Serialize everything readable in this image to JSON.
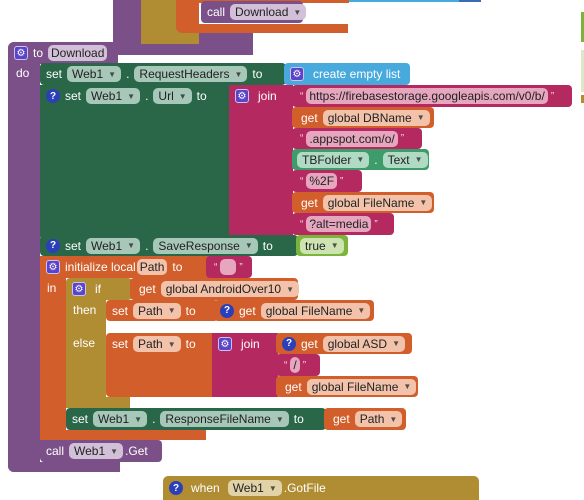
{
  "top_fragment": {
    "call_label": "call",
    "call_target": "Download"
  },
  "procedure": {
    "to_label": "to",
    "name": "Download",
    "do_label": "do"
  },
  "set_headers": {
    "set_label": "set",
    "component": "Web1",
    "property": "RequestHeaders",
    "to_label": "to",
    "value_block": "create empty list"
  },
  "set_url": {
    "set_label": "set",
    "component": "Web1",
    "property": "Url",
    "to_label": "to",
    "join_label": "join",
    "parts": [
      {
        "type": "text",
        "value": "https://firebasestorage.googleapis.com/v0/b/"
      },
      {
        "type": "get",
        "get_label": "get",
        "var": "global DBName"
      },
      {
        "type": "text",
        "value": ".appspot.com/o/"
      },
      {
        "type": "component",
        "component": "TBFolder",
        "property": "Text"
      },
      {
        "type": "text",
        "value": "%2F"
      },
      {
        "type": "get",
        "get_label": "get",
        "var": "global FileName"
      },
      {
        "type": "text",
        "value": "?alt=media"
      }
    ]
  },
  "set_save": {
    "set_label": "set",
    "component": "Web1",
    "property": "SaveResponse",
    "to_label": "to",
    "value": "true"
  },
  "init_local": {
    "label": "initialize local",
    "var": "Path",
    "to_label": "to",
    "in_label": "in",
    "initial_value": ""
  },
  "if_block": {
    "if_label": "if",
    "condition_get": "get",
    "condition_var": "global AndroidOver10",
    "then_label": "then",
    "else_label": "else",
    "then_set": {
      "set_label": "set",
      "var": "Path",
      "to_label": "to",
      "get_label": "get",
      "value_var": "global FileName"
    },
    "else_set": {
      "set_label": "set",
      "var": "Path",
      "to_label": "to",
      "join_label": "join",
      "parts": [
        {
          "type": "get",
          "get_label": "get",
          "var": "global ASD"
        },
        {
          "type": "text",
          "value": "/"
        },
        {
          "type": "get",
          "get_label": "get",
          "var": "global FileName"
        }
      ]
    }
  },
  "set_filename": {
    "set_label": "set",
    "component": "Web1",
    "property": "ResponseFileName",
    "to_label": "to",
    "get_label": "get",
    "value_var": "Path"
  },
  "call_get": {
    "call_label": "call",
    "component": "Web1",
    "method": ".Get"
  },
  "event": {
    "when_label": "when",
    "component": "Web1",
    "event": ".GotFile"
  }
}
